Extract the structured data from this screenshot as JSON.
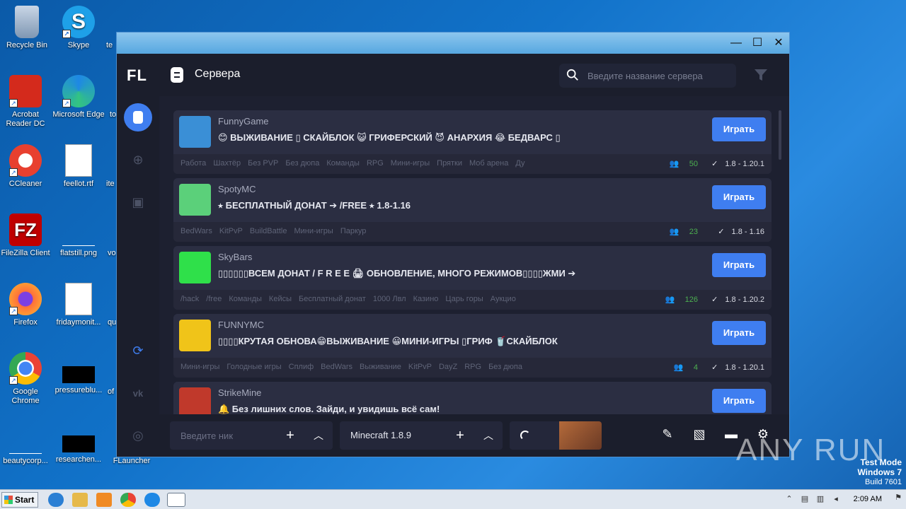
{
  "desktop": {
    "icons": [
      {
        "label": "Recycle Bin",
        "icon": "recycle-bin-icon"
      },
      {
        "label": "Skype",
        "icon": "skype-icon"
      },
      {
        "label": "Acrobat Reader DC",
        "icon": "acrobat-icon"
      },
      {
        "label": "Microsoft Edge",
        "icon": "edge-icon"
      },
      {
        "label": "CCleaner",
        "icon": "ccleaner-icon"
      },
      {
        "label": "feellot.rtf",
        "icon": "word-doc-icon"
      },
      {
        "label": "FileZilla Client",
        "icon": "filezilla-icon"
      },
      {
        "label": "flatstill.png",
        "icon": "image-file-icon"
      },
      {
        "label": "Firefox",
        "icon": "firefox-icon"
      },
      {
        "label": "fridaymonit...",
        "icon": "word-doc-icon"
      },
      {
        "label": "Google Chrome",
        "icon": "chrome-icon"
      },
      {
        "label": "pressureblu...",
        "icon": "black-file-icon"
      },
      {
        "label": "beautycorp...",
        "icon": "file-icon"
      },
      {
        "label": "researchen...",
        "icon": "black-file-icon"
      },
      {
        "label": "FLauncher",
        "icon": "flauncher-icon"
      }
    ],
    "partial_labels": [
      "te",
      "to",
      "ite",
      "vo",
      "qu",
      "of"
    ]
  },
  "app": {
    "logo": "FL",
    "title": "Сервера",
    "search_placeholder": "Введите название сервера",
    "play_label": "Играть",
    "servers": [
      {
        "name": "FunnyGame",
        "desc": "😊 ВЫЖИВАНИЕ ▯ СКАЙБЛОК 😺 ГРИФЕРСКИЙ 😈 АНАРХИЯ 😂 БЕДВАРС ▯",
        "tags": [
          "Работа",
          "Шахтёр",
          "Без PVP",
          "Без дюпа",
          "Команды",
          "RPG",
          "Мини-игры",
          "Прятки",
          "Моб арена",
          "Ду"
        ],
        "online": "50",
        "versions": "1.8 - 1.20.1",
        "thumb": "#3a8fd6"
      },
      {
        "name": "SpotyMC",
        "desc": "⭑ БЕСПЛАТНЫЙ ДОНАТ ➔ /FREE ⭑ 1.8-1.16",
        "tags": [
          "BedWars",
          "KitPvP",
          "BuildBattle",
          "Мини-игры",
          "Паркур"
        ],
        "online": "23",
        "versions": "1.8 - 1.16",
        "thumb": "#5bd07a"
      },
      {
        "name": "SkyBars",
        "desc": "▯▯▯▯▯▯ВСЕМ ДОНАТ / F R E E 🖨 ОБНОВЛЕНИЕ, МНОГО РЕЖИМОВ▯▯▯▯ЖМИ ➔",
        "tags": [
          "/hack",
          "/free",
          "Команды",
          "Кейсы",
          "Бесплатный донат",
          "1000 Лвл",
          "Казино",
          "Царь горы",
          "Аукцио"
        ],
        "online": "126",
        "versions": "1.8 - 1.20.2",
        "thumb": "#2fe04a"
      },
      {
        "name": "FUNNYMC",
        "desc": "▯▯▯▯КРУТАЯ ОБНОВА😁ВЫЖИВАНИЕ 😀МИНИ-ИГРЫ ▯ГРИФ 🥤СКАЙБЛОК",
        "tags": [
          "Мини-игры",
          "Голодные игры",
          "Сплиф",
          "BedWars",
          "Выживание",
          "KitPvP",
          "DayZ",
          "RPG",
          "Без дюпа"
        ],
        "online": "4",
        "versions": "1.8 - 1.20.1",
        "thumb": "#f0c419"
      },
      {
        "name": "StrikeMine",
        "desc": "🔔 Без лишних слов. Зайди, и увидишь всё сам!",
        "tags": [],
        "online": "",
        "versions": "",
        "thumb": "#c0392b"
      }
    ],
    "nick_placeholder": "Введите ник",
    "version_label": "Minecraft 1.8.9"
  },
  "taskbar": {
    "start": "Start",
    "time": "2:09 AM"
  },
  "watermark": {
    "line1": "Test Mode",
    "line2": "Windows 7",
    "line3": "Build 7601",
    "brand": "ANY RUN"
  }
}
